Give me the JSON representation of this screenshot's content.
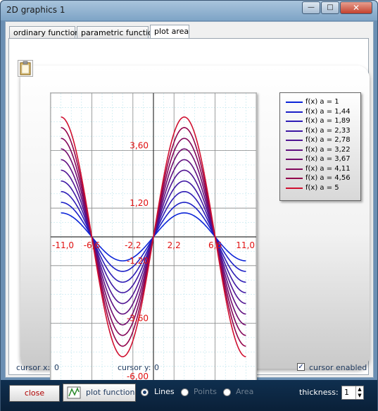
{
  "window": {
    "title": "2D graphics 1"
  },
  "titlebar_buttons": {
    "minimize": "—",
    "maximize": "□",
    "close": "✕"
  },
  "tabs": [
    {
      "label": "ordinary functions",
      "active": false
    },
    {
      "label": "parametric function",
      "active": false
    },
    {
      "label": "plot area",
      "active": true
    }
  ],
  "chart_data": {
    "type": "line",
    "x_ticks": [
      "-11,0",
      "-6,6",
      "-2,2",
      "2,2",
      "6,6",
      "11,0"
    ],
    "y_ticks": [
      "3,60",
      "1,20",
      "-1,20",
      "-3,60",
      "-6,00"
    ],
    "xlim": [
      -11.0,
      11.0
    ],
    "ylim": [
      -6.0,
      6.0
    ],
    "grid": true,
    "legend": "top-right",
    "series": [
      {
        "name": "f(x) a = 1",
        "a": 1.0,
        "color": "#0b24d8"
      },
      {
        "name": "f(x) a = 1,44",
        "a": 1.44,
        "color": "#1c20c6"
      },
      {
        "name": "f(x) a = 1,89",
        "a": 1.89,
        "color": "#2d1cb5"
      },
      {
        "name": "f(x) a = 2,33",
        "a": 2.33,
        "color": "#3e18a3"
      },
      {
        "name": "f(x) a = 2,78",
        "a": 2.78,
        "color": "#4f1492"
      },
      {
        "name": "f(x) a = 3,22",
        "a": 3.22,
        "color": "#601080"
      },
      {
        "name": "f(x) a = 3,67",
        "a": 3.67,
        "color": "#710c6e"
      },
      {
        "name": "f(x) a = 4,11",
        "a": 4.11,
        "color": "#82085c"
      },
      {
        "name": "f(x) a = 4,56",
        "a": 4.56,
        "color": "#93044b"
      },
      {
        "name": "f(x) a = 5",
        "a": 5.0,
        "color": "#d01030"
      }
    ],
    "x_range": [
      -9.9,
      9.9
    ]
  },
  "status": {
    "cursor_x_label": "cursor x:",
    "cursor_x_value": "0",
    "cursor_y_label": "cursor y:",
    "cursor_y_value": "0",
    "cursor_enabled_label": "cursor enabled",
    "cursor_enabled": true
  },
  "bottom": {
    "close_label": "close",
    "plot_label": "plot function",
    "radio_lines": "Lines",
    "radio_points": "Points",
    "radio_area": "Area",
    "thickness_label": "thickness:",
    "thickness_value": "1"
  }
}
